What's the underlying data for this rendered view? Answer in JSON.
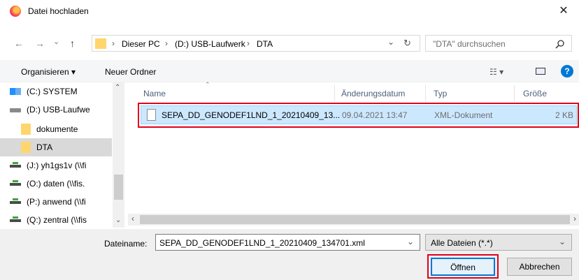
{
  "window": {
    "title": "Datei hochladen",
    "close_glyph": "✕"
  },
  "nav": {
    "back": "←",
    "forward": "→",
    "recent": "⌄",
    "up": "↑"
  },
  "address": {
    "segments": [
      "Dieser PC",
      "(D:) USB-Laufwerk",
      "DTA"
    ],
    "separator": "›",
    "dropdown": "⌄",
    "refresh": "↻"
  },
  "search": {
    "placeholder": "\"DTA\" durchsuchen"
  },
  "toolbar": {
    "organize": "Organisieren ▾",
    "new_folder": "Neuer Ordner"
  },
  "sidebar": {
    "items": [
      {
        "label": "(C:) SYSTEM",
        "icon": "windows-drive"
      },
      {
        "label": "(D:) USB-Laufwe",
        "icon": "usb-drive"
      },
      {
        "label": "dokumente",
        "icon": "folder"
      },
      {
        "label": "DTA",
        "icon": "folder"
      },
      {
        "label": "(J:) yh1gs1v (\\\\fi",
        "icon": "network-drive"
      },
      {
        "label": "(O:) daten (\\\\fis.",
        "icon": "network-drive"
      },
      {
        "label": "(P:) anwend (\\\\fi",
        "icon": "network-drive"
      },
      {
        "label": "(Q:) zentral (\\\\fis",
        "icon": "network-drive"
      }
    ]
  },
  "columns": {
    "name": "Name",
    "date": "Änderungsdatum",
    "type": "Typ",
    "size": "Größe"
  },
  "files": [
    {
      "name": "SEPA_DD_GENODEF1LND_1_20210409_13...",
      "date": "09.04.2021 13:47",
      "type": "XML-Dokument",
      "size": "2 KB"
    }
  ],
  "bottom": {
    "filename_label": "Dateiname:",
    "filename_value": "SEPA_DD_GENODEF1LND_1_20210409_134701.xml",
    "filter": "Alle Dateien (*.*)",
    "open": "Öffnen",
    "cancel": "Abbrechen"
  },
  "colors": {
    "selection": "#cce8ff",
    "highlight": "#e2001a",
    "accent": "#0078d7"
  }
}
